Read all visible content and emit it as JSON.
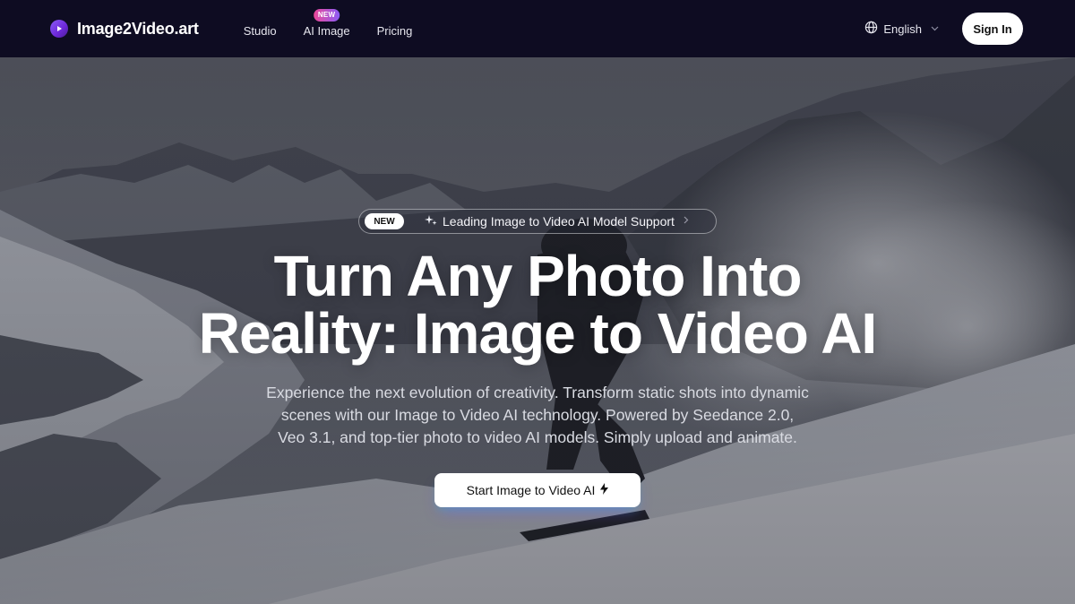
{
  "header": {
    "logo_text": "Image2Video.art",
    "nav": [
      {
        "label": "Studio"
      },
      {
        "label": "AI Image",
        "badge": "NEW"
      },
      {
        "label": "Pricing"
      }
    ],
    "language": "English",
    "sign_in": "Sign In"
  },
  "hero": {
    "pill_badge": "NEW",
    "pill_text": "Leading Image to Video AI Model Support",
    "title_line1": "Turn Any Photo Into",
    "title_line2": "Reality: Image to Video AI",
    "subtitle_line1": "Experience the next evolution of creativity. Transform static shots into dynamic",
    "subtitle_line2": "scenes with our Image to Video AI technology. Powered by Seedance 2.0,",
    "subtitle_line3": "Veo 3.1, and top-tier photo to video AI models. Simply upload and animate.",
    "cta_label": "Start Image to Video AI"
  },
  "icons": {
    "logo": "play-circle-icon",
    "language": "globe-icon",
    "pill": "sparkle-icon",
    "cta": "lightning-bolt-icon"
  },
  "colors": {
    "header_bg": "#0e0c22",
    "brand_purple": "#7c3aed",
    "badge_gradient_start": "#ec4899",
    "badge_gradient_end": "#8b5cf6"
  }
}
